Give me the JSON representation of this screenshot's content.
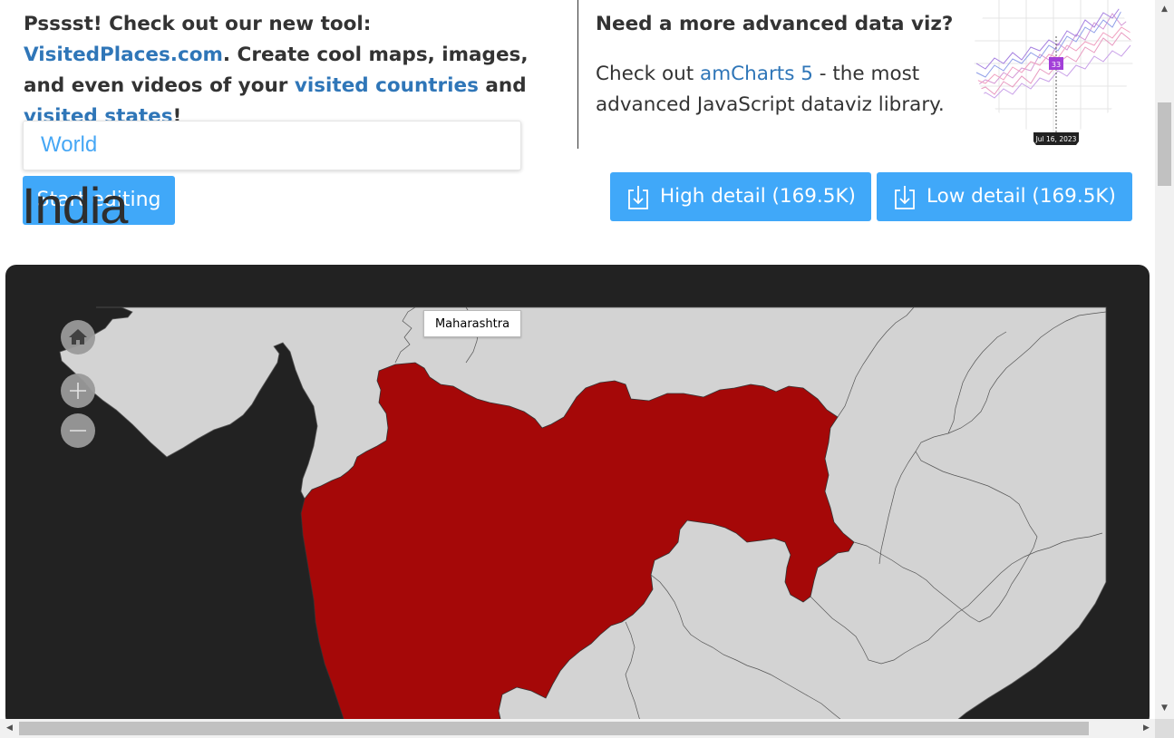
{
  "promo_left": {
    "part1": "Psssst! Check out our new tool: ",
    "link_site": "VisitedPlaces.com",
    "part2": ". Create cool maps, images, and even videos of your ",
    "link_countries": "visited countries",
    "part3": " and ",
    "link_states": "visited states",
    "part4": "!"
  },
  "promo_right": {
    "title": "Need a more advanced data viz?",
    "part1": "Check out ",
    "link": "amCharts 5",
    "part2": " - the most advanced JavaScript dataviz library.",
    "thumb_badge": "33",
    "thumb_date": "Jul 16, 2023"
  },
  "map_select": {
    "value": "World"
  },
  "start_button": {
    "label": "Start editing"
  },
  "country_title": "India",
  "downloads": {
    "high_label": "High detail (169.5K)",
    "low_label": "Low detail (169.5K)"
  },
  "map": {
    "tooltip": "Maharashtra",
    "colors": {
      "ocean": "#222222",
      "land": "#d3d3d3",
      "selected_state": "#a50808",
      "borders": "#555555"
    },
    "controls": {
      "home": "home-icon",
      "zoom_in": "plus-icon",
      "zoom_out": "minus-icon"
    }
  },
  "colors": {
    "accent": "#40a8f9",
    "link": "#2f76b8",
    "text": "#333333"
  }
}
